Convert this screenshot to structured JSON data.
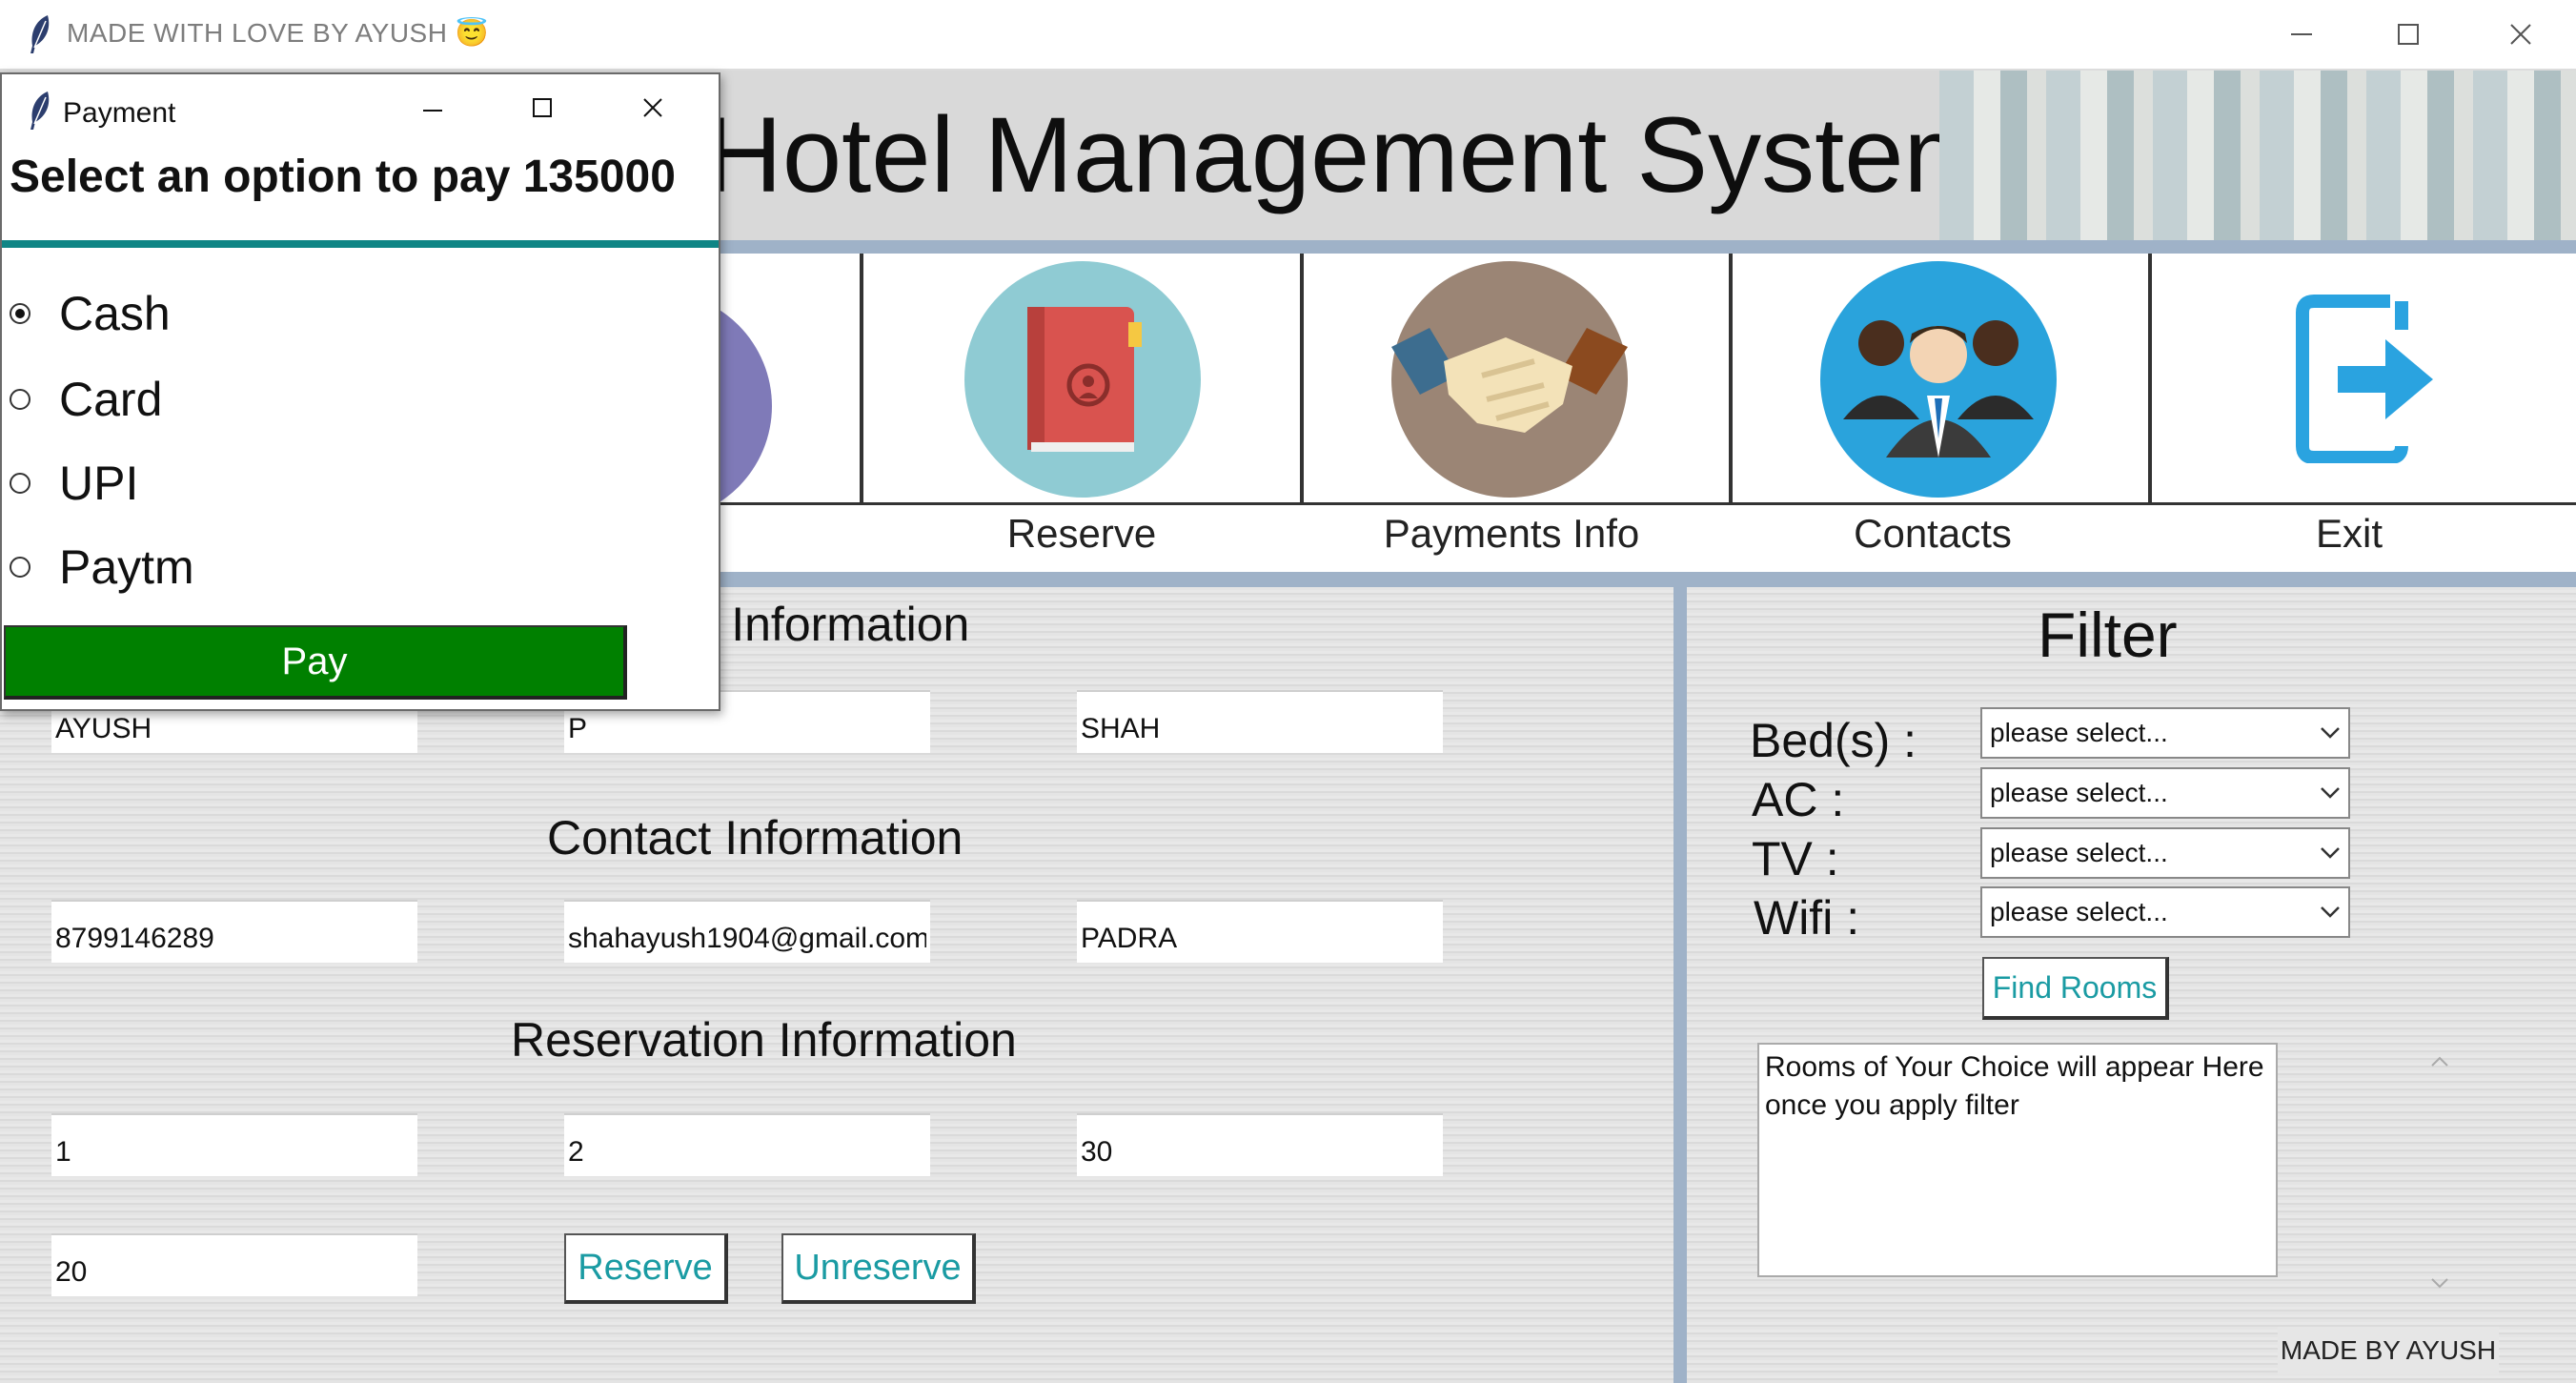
{
  "window": {
    "title": "MADE WITH LOVE BY AYUSH 😇"
  },
  "header": {
    "title": "Hotel Management System"
  },
  "nav": {
    "items": [
      {
        "label": "Reserve",
        "icon": "notebook-icon"
      },
      {
        "label": "Payments Info",
        "icon": "handshake-icon"
      },
      {
        "label": "Contacts",
        "icon": "people-icon"
      },
      {
        "label": "Exit",
        "icon": "exit-icon"
      }
    ]
  },
  "personal": {
    "heading": "Personal Information",
    "first_name": "AYUSH",
    "middle_name": "P",
    "last_name": "SHAH"
  },
  "contact": {
    "heading": "Contact Information",
    "phone": "8799146289",
    "email": "shahayush1904@gmail.com",
    "city": "PADRA"
  },
  "reservation": {
    "heading": "Reservation Information",
    "f1": "1",
    "f2": "2",
    "f3": "30",
    "f4": "20",
    "reserve_label": "Reserve",
    "unreserve_label": "Unreserve"
  },
  "filter": {
    "heading": "Filter",
    "labels": [
      "Bed(s) :",
      "AC :",
      "TV :",
      "Wifi :"
    ],
    "combo_value": "please select...",
    "find_label": "Find Rooms",
    "results_text": "Rooms of Your Choice will appear Here once you apply filter",
    "footer": "MADE BY AYUSH"
  },
  "dialog": {
    "title": "Payment",
    "prompt": "Select an option to pay 135000",
    "options": [
      "Cash",
      "Card",
      "UPI",
      "Paytm"
    ],
    "selected": "Cash",
    "pay_label": "Pay"
  },
  "colors": {
    "accent": "#0f8585",
    "pay_button": "#008000",
    "button_text": "#1a9ba3",
    "rule": "#9fb2c8"
  }
}
